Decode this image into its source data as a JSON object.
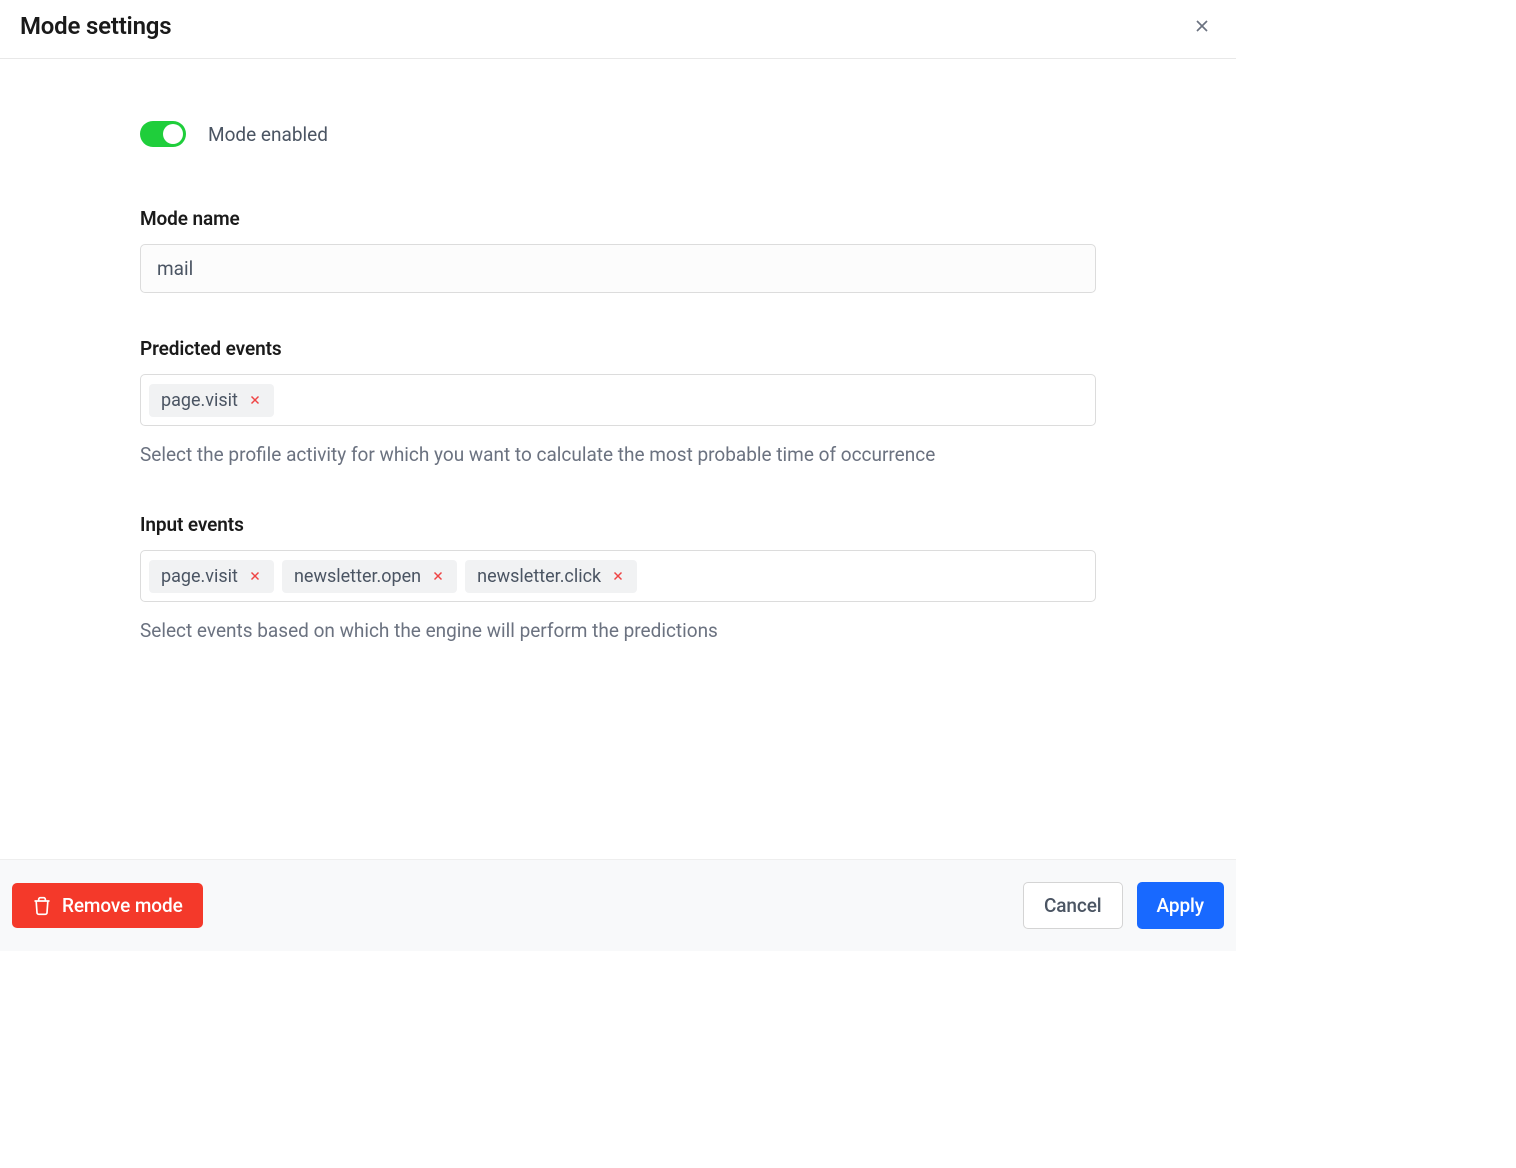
{
  "header": {
    "title": "Mode settings"
  },
  "toggle": {
    "label": "Mode enabled",
    "enabled": true
  },
  "mode_name": {
    "label": "Mode name",
    "value": "mail"
  },
  "predicted_events": {
    "label": "Predicted events",
    "tags": [
      "page.visit"
    ],
    "helper": "Select the profile activity for which you want to calculate the most probable time of occurrence"
  },
  "input_events": {
    "label": "Input events",
    "tags": [
      "page.visit",
      "newsletter.open",
      "newsletter.click"
    ],
    "helper": "Select events based on which the engine will perform the predictions"
  },
  "footer": {
    "remove_label": "Remove mode",
    "cancel_label": "Cancel",
    "apply_label": "Apply"
  }
}
